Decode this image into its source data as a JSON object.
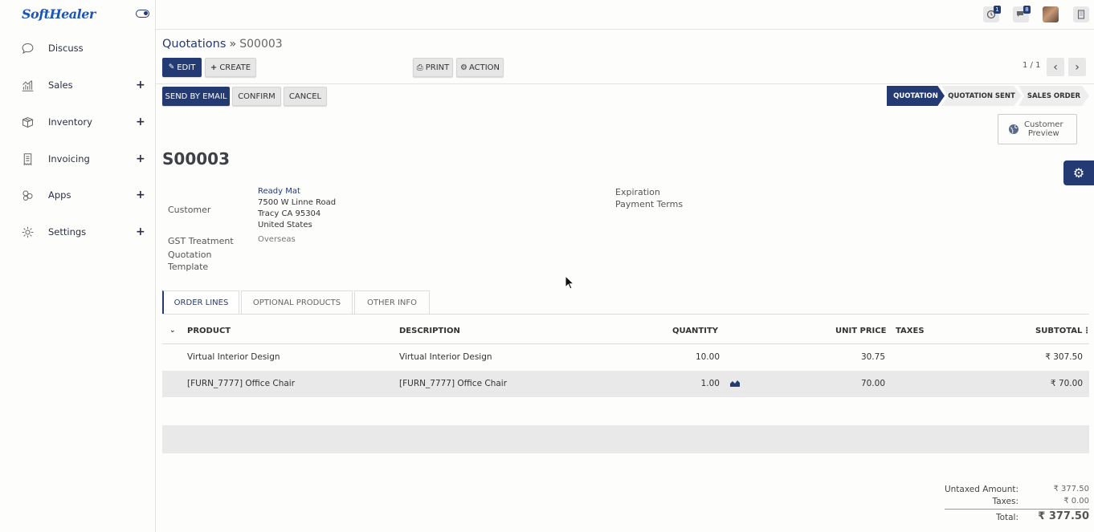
{
  "brand": {
    "logo": "SoftHealer"
  },
  "sidebar": {
    "items": [
      {
        "label": "Discuss",
        "icon": "chat-icon",
        "has_plus": false
      },
      {
        "label": "Sales",
        "icon": "chart-icon",
        "has_plus": true
      },
      {
        "label": "Inventory",
        "icon": "box-icon",
        "has_plus": true
      },
      {
        "label": "Invoicing",
        "icon": "receipt-icon",
        "has_plus": true
      },
      {
        "label": "Apps",
        "icon": "apps-icon",
        "has_plus": true
      },
      {
        "label": "Settings",
        "icon": "gear-icon",
        "has_plus": true
      }
    ],
    "plus": "+"
  },
  "topbar": {
    "activity_count": "1",
    "messages_count": "8"
  },
  "breadcrumb": {
    "parent": "Quotations",
    "separator": "»",
    "current": "S00003"
  },
  "toolbar": {
    "edit": "EDIT",
    "create": "CREATE",
    "print": "PRINT",
    "action": "ACTION",
    "pager": "1 / 1"
  },
  "actions": {
    "send": "SEND BY EMAIL",
    "confirm": "CONFIRM",
    "cancel": "CANCEL"
  },
  "status": {
    "stages": [
      "QUOTATION",
      "QUOTATION SENT",
      "SALES ORDER"
    ],
    "active": "QUOTATION"
  },
  "customer_preview": {
    "line1": "Customer",
    "line2": "Preview"
  },
  "record": {
    "name": "S00003",
    "customer_label": "Customer",
    "customer_name": "Ready Mat",
    "address": [
      "7500 W Linne Road",
      "Tracy CA 95304",
      "United States"
    ],
    "gst_label": "GST Treatment",
    "gst_value": "Overseas",
    "template_label_1": "Quotation",
    "template_label_2": "Template",
    "expiration_label": "Expiration",
    "payment_terms_label": "Payment Terms"
  },
  "tabs": [
    "ORDER LINES",
    "OPTIONAL PRODUCTS",
    "OTHER INFO"
  ],
  "table": {
    "headers": {
      "product": "PRODUCT",
      "description": "DESCRIPTION",
      "quantity": "QUANTITY",
      "unit_price": "UNIT PRICE",
      "taxes": "TAXES",
      "subtotal": "SUBTOTAL"
    },
    "rows": [
      {
        "product": "Virtual Interior Design",
        "description": "Virtual Interior Design",
        "quantity": "10.00",
        "unit_price": "30.75",
        "subtotal": "₹ 307.50"
      },
      {
        "product": "[FURN_7777] Office Chair",
        "description": "[FURN_7777] Office Chair",
        "quantity": "1.00",
        "unit_price": "70.00",
        "subtotal": "₹ 70.00"
      }
    ]
  },
  "totals": {
    "untaxed_label": "Untaxed Amount:",
    "untaxed_value": "₹ 377.50",
    "taxes_label": "Taxes:",
    "taxes_value": "₹ 0.00",
    "total_label": "Total:",
    "total_value": "₹ 377.50"
  },
  "colors": {
    "primary": "#233a73",
    "row_alt": "#e9e9e9"
  }
}
